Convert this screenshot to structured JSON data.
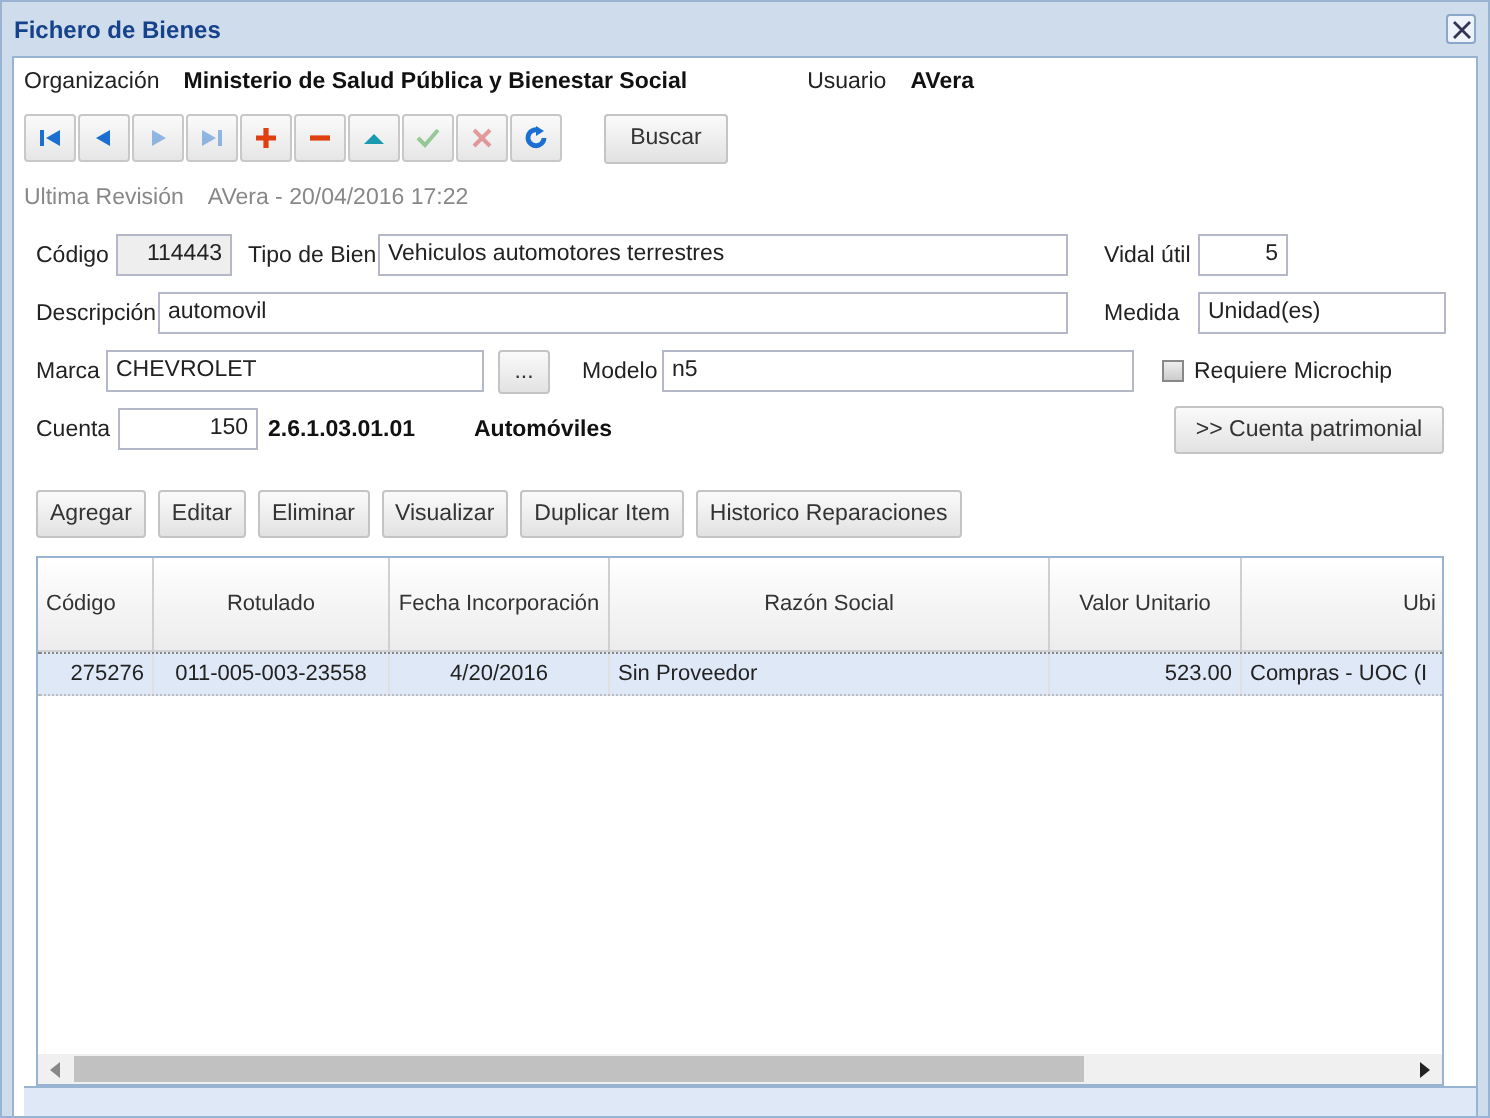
{
  "window": {
    "title": "Fichero de Bienes"
  },
  "header": {
    "organization_label": "Organización",
    "organization": "Ministerio de Salud Pública y Bienestar Social",
    "user_label": "Usuario",
    "user": "AVera"
  },
  "toolbar": [
    {
      "kind": "first",
      "disabled": false
    },
    {
      "kind": "prev",
      "disabled": false
    },
    {
      "kind": "next",
      "disabled": true
    },
    {
      "kind": "last",
      "disabled": true
    },
    {
      "kind": "add",
      "disabled": false
    },
    {
      "kind": "remove",
      "disabled": false
    },
    {
      "kind": "up",
      "disabled": false
    },
    {
      "kind": "accept",
      "disabled": true
    },
    {
      "kind": "cancel",
      "disabled": true
    },
    {
      "kind": "refresh",
      "disabled": false
    }
  ],
  "search_button": "Buscar",
  "revision": {
    "label": "Ultima Revisión",
    "value": "AVera - 20/04/2016 17:22"
  },
  "form": {
    "codigo_label": "Código",
    "codigo": "114443",
    "tipo_label": "Tipo de Bien",
    "tipo": "Vehiculos automotores terrestres",
    "vida_label": "Vidal útil",
    "vida": "5",
    "descripcion_label": "Descripción",
    "descripcion": "automovil",
    "medida_label": "Medida",
    "medida": "Unidad(es)",
    "marca_label": "Marca",
    "marca": "CHEVROLET",
    "marca_button": "...",
    "modelo_label": "Modelo",
    "modelo": "n5",
    "microchip": {
      "label": "Requiere Microchip",
      "checked": false
    },
    "cuenta_label": "Cuenta",
    "cuenta": "150",
    "cuenta_code": "2.6.1.03.01.01",
    "cuenta_name": "Automóviles",
    "cuenta_button": ">> Cuenta patrimonial"
  },
  "actions": [
    "Agregar",
    "Editar",
    "Eliminar",
    "Visualizar",
    "Duplicar Item",
    "Historico Reparaciones"
  ],
  "table": {
    "columns": [
      {
        "label": "Código"
      },
      {
        "label": "Rotulado"
      },
      {
        "label": "Fecha Incorporación"
      },
      {
        "label": "Razón Social"
      },
      {
        "label": "Valor Unitario"
      },
      {
        "label": "Ubi"
      }
    ],
    "rows": [
      {
        "selected": true,
        "cells": [
          "275276",
          "011-005-003-23558",
          "4/20/2016",
          "Sin Proveedor",
          "523.00",
          "Compras - UOC (I"
        ]
      }
    ]
  }
}
